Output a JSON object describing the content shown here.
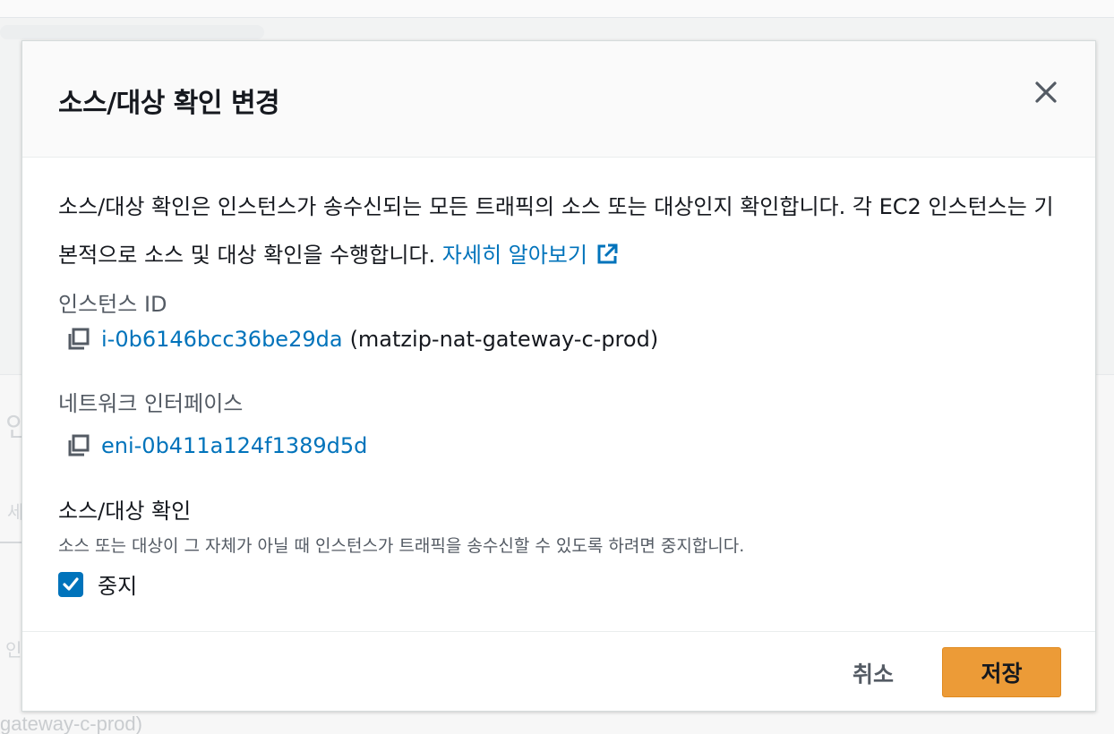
{
  "background": {
    "fragments": [
      "인",
      "세",
      "인"
    ],
    "footer_text": "gateway-c-prod)"
  },
  "modal": {
    "title": "소스/대상 확인 변경",
    "close_icon": "close-icon",
    "description": "소스/대상 확인은 인스턴스가 송수신되는 모든 트래픽의 소스 또는 대상인지 확인합니다. 각 EC2 인스턴스는 기본적으로 소스 및 대상 확인을 수행합니다.",
    "learn_more_link": "자세히 알아보기",
    "instance_id_label": "인스턴스 ID",
    "instance_id": "i-0b6146bcc36be29da",
    "instance_name": "(matzip-nat-gateway-c-prod)",
    "network_interface_label": "네트워크 인터페이스",
    "network_interface_id": "eni-0b411a124f1389d5d",
    "source_dest_label": "소스/대상 확인",
    "source_dest_help": "소스 또는 대상이 그 자체가 아닐 때 인스턴스가 트래픽을 송수신할 수 있도록 하려면 중지합니다.",
    "stop_checkbox_label": "중지",
    "stop_checked": true,
    "cancel_label": "취소",
    "save_label": "저장"
  },
  "colors": {
    "link": "#0073bb",
    "primary_button": "#ec9b37",
    "checkbox": "#0073bb"
  }
}
